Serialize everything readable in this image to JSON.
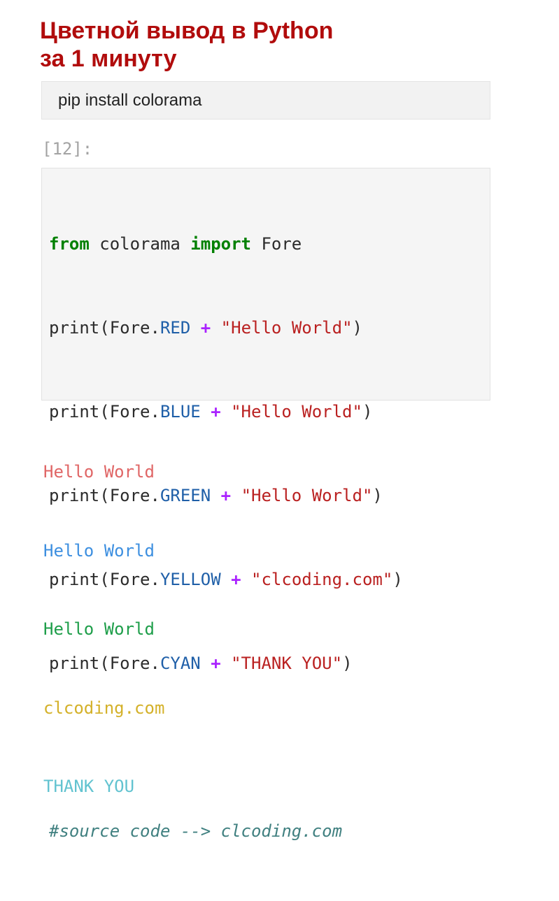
{
  "title": {
    "line1": "Цветной вывод в Python",
    "line2": "за 1 минуту",
    "color": "#b10c0c"
  },
  "install_cell": {
    "text": "pip install colorama"
  },
  "code_cell": {
    "prompt": "[12]:",
    "lines": [
      {
        "kw1": "from",
        "t1": " colorama ",
        "kw2": "import",
        "t2": " Fore"
      },
      {
        "pre": "print(Fore.",
        "attr": "RED",
        "sp1": " ",
        "op": "+",
        "sp2": " ",
        "str": "\"Hello World\"",
        "post": ")"
      },
      {
        "pre": "print(Fore.",
        "attr": "BLUE",
        "sp1": " ",
        "op": "+",
        "sp2": " ",
        "str": "\"Hello World\"",
        "post": ")"
      },
      {
        "pre": "print(Fore.",
        "attr": "GREEN",
        "sp1": " ",
        "op": "+",
        "sp2": " ",
        "str": "\"Hello World\"",
        "post": ")"
      },
      {
        "pre": "print(Fore.",
        "attr": "YELLOW",
        "sp1": " ",
        "op": "+",
        "sp2": " ",
        "str": "\"clcoding.com\"",
        "post": ")"
      },
      {
        "pre": "print(Fore.",
        "attr": "CYAN",
        "sp1": " ",
        "op": "+",
        "sp2": " ",
        "str": "\"THANK YOU\"",
        "post": ")"
      }
    ],
    "comment": "#source code --> clcoding.com"
  },
  "output": {
    "lines": [
      {
        "text": "Hello World",
        "color": "#e06666"
      },
      {
        "text": "Hello World",
        "color": "#3d8fe0"
      },
      {
        "text": "Hello World",
        "color": "#1e9e4a"
      },
      {
        "text": "clcoding.com",
        "color": "#d4b12a"
      },
      {
        "text": "THANK YOU",
        "color": "#62c3d0"
      }
    ]
  }
}
